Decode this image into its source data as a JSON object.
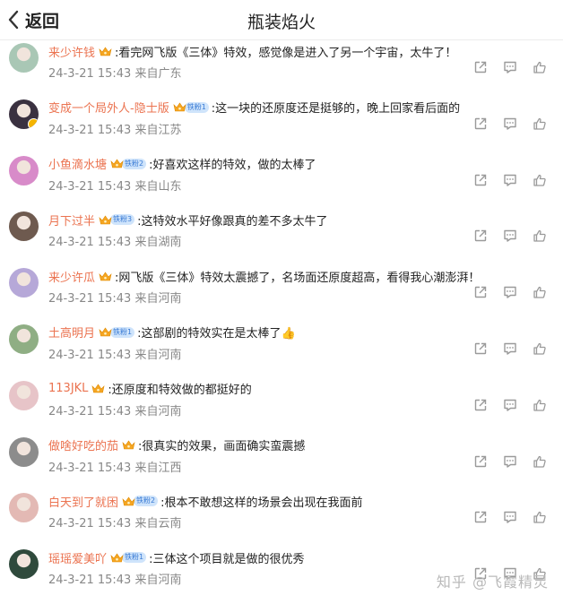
{
  "header": {
    "back_label": "返回",
    "title": "瓶装焰火"
  },
  "comments": [
    {
      "user": "来少许钱",
      "fans": "",
      "text": ":看完网飞版《三体》特效，感觉像是进入了另一个宇宙，太牛了！",
      "time": "24-3-21 15:43",
      "location": "来自广东",
      "avatar_color": "#a9c7b5"
    },
    {
      "user": "变成一个局外人-隐士版",
      "fans": "铁粉1",
      "text": ":这一块的还原度还是挺够的，晚上回家看后面的",
      "time": "24-3-21 15:43",
      "location": "来自江苏",
      "avatar_color": "#3a3140"
    },
    {
      "user": "小鱼滴水塘",
      "fans": "铁粉2",
      "text": ":好喜欢这样的特效，做的太棒了",
      "time": "24-3-21 15:43",
      "location": "来自山东",
      "avatar_color": "#d88bc9"
    },
    {
      "user": "月下过半",
      "fans": "铁粉3",
      "text": ":这特效水平好像跟真的差不多太牛了",
      "time": "24-3-21 15:43",
      "location": "来自湖南",
      "avatar_color": "#6e5a4f"
    },
    {
      "user": "来少许瓜",
      "fans": "",
      "text": ":网飞版《三体》特效太震撼了，名场面还原度超高，看得我心潮澎湃！",
      "time": "24-3-21 15:43",
      "location": "来自河南",
      "avatar_color": "#b6a8d8"
    },
    {
      "user": "土高明月",
      "fans": "铁粉1",
      "text": ":这部剧的特效实在是太棒了👍",
      "time": "24-3-21 15:43",
      "location": "来自河南",
      "avatar_color": "#8fae84"
    },
    {
      "user": "113JKL",
      "fans": "",
      "text": ":还原度和特效做的都挺好的",
      "time": "24-3-21 15:43",
      "location": "来自河南",
      "avatar_color": "#e7c4c8"
    },
    {
      "user": "做啥好吃的茄",
      "fans": "",
      "text": ":很真实的效果，画面确实蛮震撼",
      "time": "24-3-21 15:43",
      "location": "来自江西",
      "avatar_color": "#8c8c8c"
    },
    {
      "user": "白天到了就困",
      "fans": "铁粉2",
      "text": ":根本不敢想这样的场景会出现在我面前",
      "time": "24-3-21 15:43",
      "location": "来自云南",
      "avatar_color": "#e3b9b4"
    },
    {
      "user": "瑶瑶爱美吖",
      "fans": "铁粉1",
      "text": ":三体这个项目就是做的很优秀",
      "time": "24-3-21 15:43",
      "location": "来自河南",
      "avatar_color": "#2f4a3c"
    }
  ],
  "watermark": "知乎 @飞霞精灵",
  "colors": {
    "username": "#eb7350",
    "meta": "#888888",
    "fans_badge_bg": "#cfe4fb",
    "fans_badge_text": "#3a7bd5",
    "icon": "#9a9a9a"
  },
  "icons": [
    "share-icon",
    "comment-icon",
    "like-icon"
  ]
}
